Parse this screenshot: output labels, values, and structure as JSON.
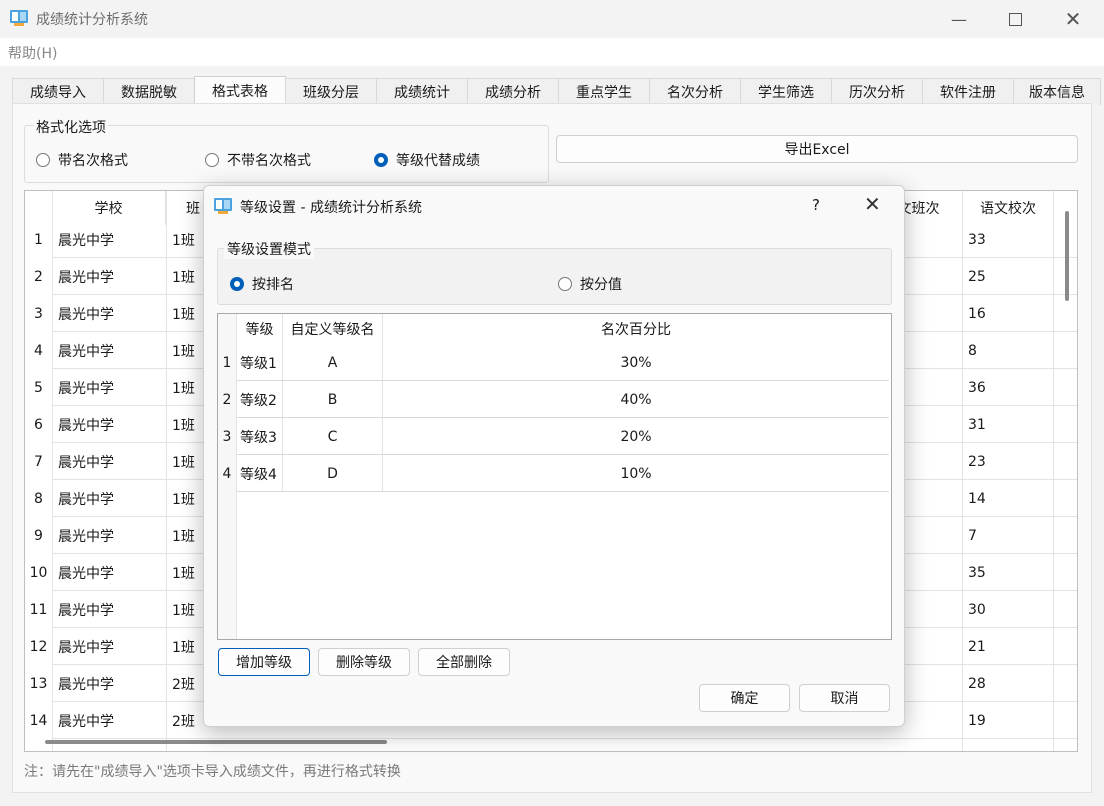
{
  "window": {
    "title": "成绩统计分析系统"
  },
  "menu": {
    "help": "帮助(H)"
  },
  "tabs": [
    "成绩导入",
    "数据脱敏",
    "格式表格",
    "班级分层",
    "成绩统计",
    "成绩分析",
    "重点学生",
    "名次分析",
    "学生筛选",
    "历次分析",
    "软件注册",
    "版本信息"
  ],
  "format_options": {
    "title": "格式化选项",
    "options": [
      "带名次格式",
      "不带名次格式",
      "等级代替成绩"
    ],
    "selected": "等级代替成绩"
  },
  "export_label": "导出Excel",
  "table": {
    "headers": [
      "学校",
      "班",
      "文班次",
      "语文校次"
    ],
    "rows": [
      {
        "n": "1",
        "school": "晨光中学",
        "cls": "1班",
        "rank": "33"
      },
      {
        "n": "2",
        "school": "晨光中学",
        "cls": "1班",
        "rank": "25"
      },
      {
        "n": "3",
        "school": "晨光中学",
        "cls": "1班",
        "rank": "16"
      },
      {
        "n": "4",
        "school": "晨光中学",
        "cls": "1班",
        "rank": "8"
      },
      {
        "n": "5",
        "school": "晨光中学",
        "cls": "1班",
        "rank": "36"
      },
      {
        "n": "6",
        "school": "晨光中学",
        "cls": "1班",
        "rank": "31"
      },
      {
        "n": "7",
        "school": "晨光中学",
        "cls": "1班",
        "rank": "23"
      },
      {
        "n": "8",
        "school": "晨光中学",
        "cls": "1班",
        "rank": "14"
      },
      {
        "n": "9",
        "school": "晨光中学",
        "cls": "1班",
        "rank": "7"
      },
      {
        "n": "10",
        "school": "晨光中学",
        "cls": "1班",
        "rank": "35"
      },
      {
        "n": "11",
        "school": "晨光中学",
        "cls": "1班",
        "rank": "30"
      },
      {
        "n": "12",
        "school": "晨光中学",
        "cls": "1班",
        "rank": "21"
      },
      {
        "n": "13",
        "school": "晨光中学",
        "cls": "2班",
        "rank": "28"
      },
      {
        "n": "14",
        "school": "晨光中学",
        "cls": "2班",
        "rank": "19"
      }
    ]
  },
  "note": "注：请先在\"成绩导入\"选项卡导入成绩文件，再进行格式转换",
  "dialog": {
    "title": "等级设置 - 成绩统计分析系统",
    "help": "?",
    "mode_title": "等级设置模式",
    "mode_options": [
      "按排名",
      "按分值"
    ],
    "mode_selected": "按排名",
    "headers": [
      "等级",
      "自定义等级名",
      "名次百分比"
    ],
    "rows": [
      {
        "n": "1",
        "level": "等级1",
        "name": "A",
        "pct": "30%"
      },
      {
        "n": "2",
        "level": "等级2",
        "name": "B",
        "pct": "40%"
      },
      {
        "n": "3",
        "level": "等级3",
        "name": "C",
        "pct": "20%"
      },
      {
        "n": "4",
        "level": "等级4",
        "name": "D",
        "pct": "10%"
      }
    ],
    "buttons": {
      "add": "增加等级",
      "delete": "删除等级",
      "delete_all": "全部删除",
      "ok": "确定",
      "cancel": "取消"
    }
  }
}
